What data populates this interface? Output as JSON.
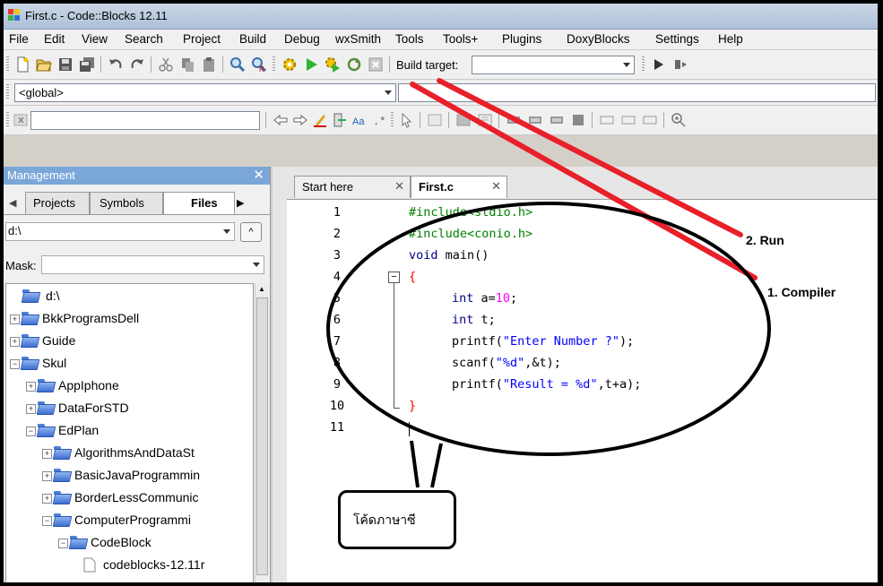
{
  "window": {
    "title": "First.c - Code::Blocks 12.11"
  },
  "menu": [
    "File",
    "Edit",
    "View",
    "Search",
    "Project",
    "Build",
    "Debug",
    "wxSmith",
    "Tools",
    "Tools+",
    "Plugins",
    "DoxyBlocks",
    "Settings",
    "Help"
  ],
  "toolbar": {
    "build_target_label": "Build target:",
    "build_target_value": ""
  },
  "scope": {
    "value": "<global>"
  },
  "search": {
    "value": ""
  },
  "management": {
    "title": "Management",
    "tabs": [
      "Projects",
      "Symbols",
      "Files"
    ],
    "drive_value": "d:\\",
    "mask_label": "Mask:",
    "mask_value": "",
    "tree": [
      {
        "label": "d:\\",
        "depth": 0,
        "state": "none"
      },
      {
        "label": "BkkProgramsDell",
        "depth": 0,
        "state": "plus"
      },
      {
        "label": "Guide",
        "depth": 0,
        "state": "plus"
      },
      {
        "label": "Skul",
        "depth": 0,
        "state": "minus"
      },
      {
        "label": "AppIphone",
        "depth": 1,
        "state": "plus"
      },
      {
        "label": "DataForSTD",
        "depth": 1,
        "state": "plus"
      },
      {
        "label": "EdPlan",
        "depth": 1,
        "state": "minus"
      },
      {
        "label": "AlgorithmsAndDataSt",
        "depth": 2,
        "state": "plus"
      },
      {
        "label": "BasicJavaProgrammin",
        "depth": 2,
        "state": "plus"
      },
      {
        "label": "BorderLessCommunic",
        "depth": 2,
        "state": "plus"
      },
      {
        "label": "ComputerProgrammi",
        "depth": 2,
        "state": "minus"
      },
      {
        "label": "CodeBlock",
        "depth": 3,
        "state": "minus"
      },
      {
        "label": "codeblocks-12.11r",
        "depth": 4,
        "state": "file"
      }
    ]
  },
  "editor": {
    "tabs": [
      {
        "label": "Start here",
        "active": false
      },
      {
        "label": "First.c",
        "active": true
      }
    ],
    "line_numbers": [
      "1",
      "2",
      "3",
      "4",
      "5",
      "6",
      "7",
      "8",
      "9",
      "10",
      "11"
    ],
    "lines": {
      "l1": "#include<stdio.h>",
      "l2": "#include<conio.h>",
      "l3a": "void",
      "l3b": " main()",
      "l4": "{",
      "l5a": "int",
      "l5b": " a=",
      "l5c": "10",
      "l5d": ";",
      "l6a": "int",
      "l6b": " t;",
      "l7a": "printf(",
      "l7b": "\"Enter Number ?\"",
      "l7c": ");",
      "l8a": "scanf(",
      "l8b": "\"%d\"",
      "l8c": ",&t);",
      "l9a": "printf(",
      "l9b": "\"Result = %d\"",
      "l9c": ",t+a);",
      "l10": "}"
    }
  },
  "annotations": {
    "run": "2. Run",
    "compiler": "1. Compiler",
    "thai_code": "โค้ดภาษาซี"
  },
  "colors": {
    "title_bg": "#b4c6dc",
    "mgmt_title": "#7aa6d8",
    "annotation_red": "#e8202a",
    "preproc": "#008000",
    "keyword": "#00008b",
    "string": "#0000ff",
    "number": "#ff00ff"
  }
}
